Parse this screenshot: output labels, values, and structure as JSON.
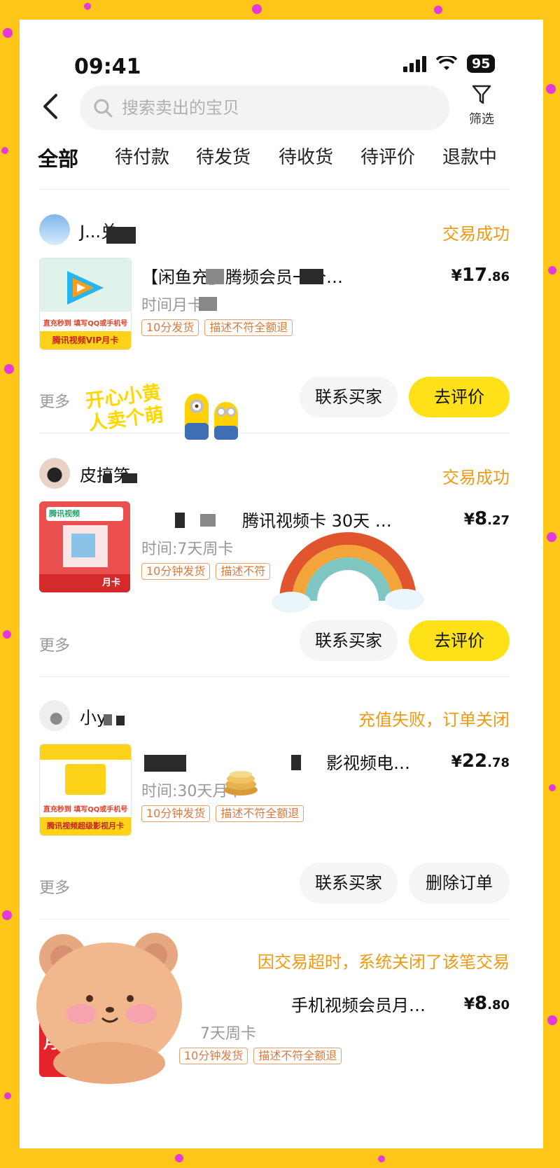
{
  "status_bar": {
    "time": "09:41",
    "battery": "95"
  },
  "search": {
    "placeholder": "搜索卖出的宝贝",
    "filter_label": "筛选"
  },
  "tabs": [
    {
      "label": "全部"
    },
    {
      "label": "待付款"
    },
    {
      "label": "待发货"
    },
    {
      "label": "待收货"
    },
    {
      "label": "待评价"
    },
    {
      "label": "退款中"
    }
  ],
  "orders": [
    {
      "buyer": "J...兑",
      "status": "交易成功",
      "title": "【闲鱼充】腾频会员一个…",
      "price_int": "17",
      "price_dec": ".86",
      "spec": "时间月卡",
      "tags": [
        "10分发货",
        "描述不符全额退"
      ],
      "thumb_lines": [
        "直充秒到 填写QQ或手机号",
        "腾讯视频VIP月卡"
      ],
      "more": "更多",
      "btn1": "联系买家",
      "btn2": "去评价"
    },
    {
      "buyer": "皮搞笑",
      "status": "交易成功",
      "title": "腾讯视频卡 30天 …",
      "price_int": "8",
      "price_dec": ".27",
      "spec": "时间:7天周卡",
      "tags": [
        "10分钟发货",
        "描述不符"
      ],
      "thumb_lines": [
        "腾讯视频",
        "月卡"
      ],
      "more": "更多",
      "btn1": "联系买家",
      "btn2": "去评价"
    },
    {
      "buyer": "小y",
      "status": "充值失败，订单关闭",
      "title": "影视频电视…",
      "price_int": "22",
      "price_dec": ".78",
      "spec": "时间:30天月卡",
      "tags": [
        "10分钟发货",
        "描述不符全额退"
      ],
      "thumb_lines": [
        "直充秒到 填写QQ或手机号",
        "腾讯视频超级影视月卡"
      ],
      "more": "更多",
      "btn1": "联系买家",
      "btn2": "删除订单"
    },
    {
      "status": "因交易超时，系统关闭了该笔交易",
      "title": "手机视频会员月…",
      "price_int": "8",
      "price_dec": ".80",
      "spec": "7天周卡",
      "tags": [
        "10分钟发货",
        "描述不符全额退"
      ],
      "thumb_lines": [
        "月卡",
        "电脑/手机/平板"
      ]
    }
  ],
  "stickers": {
    "minion_text": "开心小黄人卖个萌"
  },
  "colors": {
    "frame": "#ffc61a",
    "accent_yellow": "#ffe11a",
    "status_orange": "#ef9a12"
  }
}
